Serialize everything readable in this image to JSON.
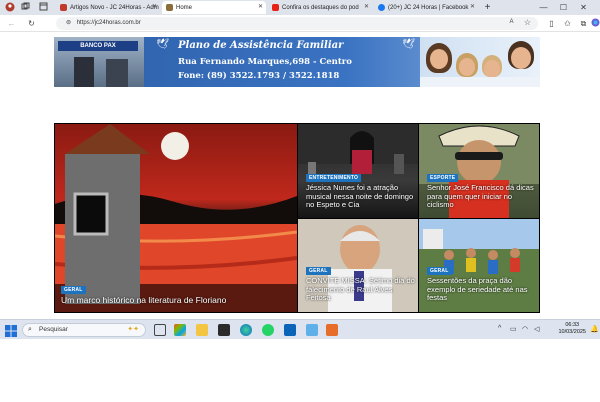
{
  "browser": {
    "tabs": [
      {
        "label": "Artigos Novo - JC 24Horas - Adm",
        "color": "#c0392b"
      },
      {
        "label": "Home",
        "color": "#8a6d3b",
        "active": true
      },
      {
        "label": "Confira os destaques do pod",
        "color": "#e62117"
      },
      {
        "label": "(20+) JC 24 Horas | Facebook",
        "color": "#1877f2"
      }
    ],
    "new_tab": "+",
    "url": "https://jc24horas.com.br",
    "window_controls": [
      "—",
      "☐",
      "✕"
    ]
  },
  "banner": {
    "store_sign": "BANCO PAX",
    "title": "Plano de Assistência Familiar",
    "address": "Rua Fernando Marques,698 - Centro",
    "phone": "Fone: (89) 3522.1793 / 3522.1818"
  },
  "news": [
    {
      "category": "GERAL",
      "title": "Um marco histórico na literatura de Floriano"
    },
    {
      "category": "ENTRETENIMENTO",
      "title": "Jéssica Nunes foi a atração musical nessa noite de domingo no Espeto e Cia"
    },
    {
      "category": "ESPORTE",
      "title": "Senhor José Francisco dá dicas para quem quer iniciar no ciclismo"
    },
    {
      "category": "GERAL",
      "title": "CONVITE MISSA: Sétimo dia do falecimento de Raul Alves Feitosa"
    },
    {
      "category": "GERAL",
      "title": "Sessentões da praça dão exemplo de seriedade até nas festas"
    }
  ],
  "taskbar": {
    "search_placeholder": "Pesquisar",
    "time": "06:33",
    "date": "10/03/2025"
  },
  "colors": {
    "accent": "#1e73be",
    "tabbar": "#dfe3eb",
    "banner_blue": "#2d5fa8"
  }
}
